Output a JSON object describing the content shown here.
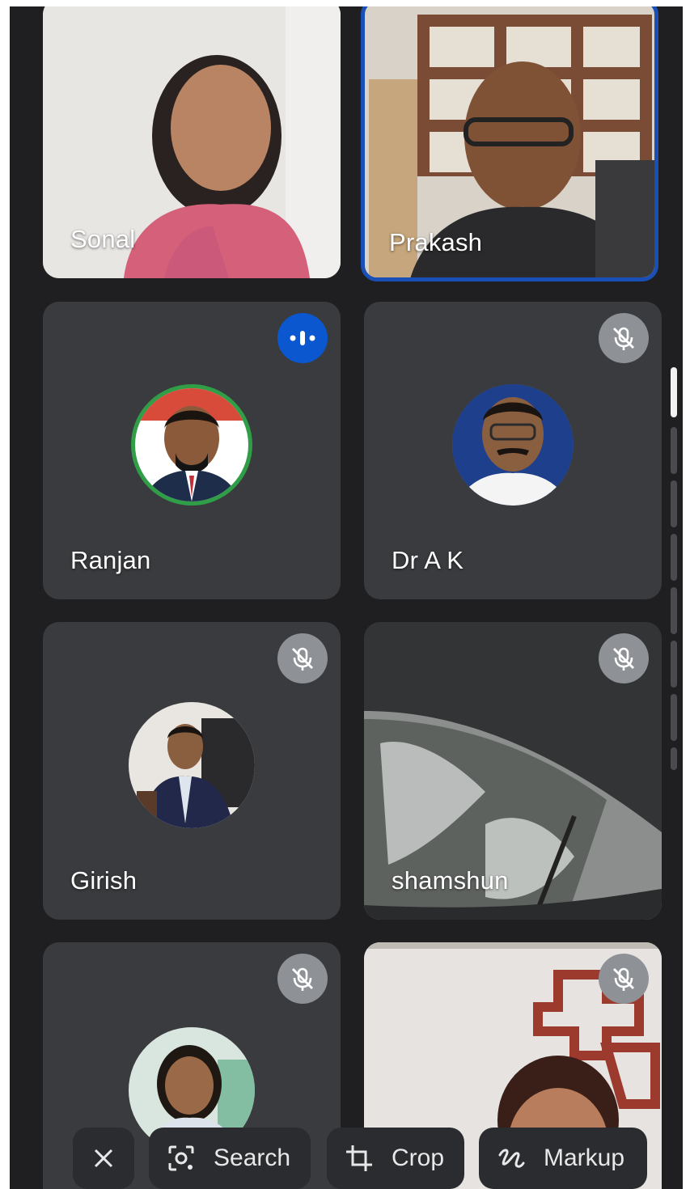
{
  "participants": [
    {
      "name": "Sonal",
      "type": "video",
      "muted": false,
      "speaking": false
    },
    {
      "name": "Prakash",
      "type": "video",
      "muted": false,
      "speaking": false,
      "active": true
    },
    {
      "name": "Ranjan",
      "type": "avatar",
      "muted": false,
      "speaking": true
    },
    {
      "name": "Dr A K",
      "type": "avatar",
      "muted": true,
      "speaking": false
    },
    {
      "name": "Girish",
      "type": "avatar",
      "muted": true,
      "speaking": false
    },
    {
      "name": "shamshun",
      "type": "video",
      "muted": true,
      "speaking": false
    },
    {
      "name": "",
      "type": "avatar",
      "muted": true,
      "speaking": false
    },
    {
      "name": "",
      "type": "video",
      "muted": true,
      "speaking": false
    }
  ],
  "toolbar": {
    "close_icon": "close-icon",
    "search_label": "Search",
    "crop_label": "Crop",
    "markup_label": "Markup"
  },
  "colors": {
    "background": "#1f1f21",
    "tile": "#3a3b3e",
    "active_border": "#1a4fb5",
    "speaking_badge": "#0b57d0",
    "muted_badge": "#8e9196"
  }
}
